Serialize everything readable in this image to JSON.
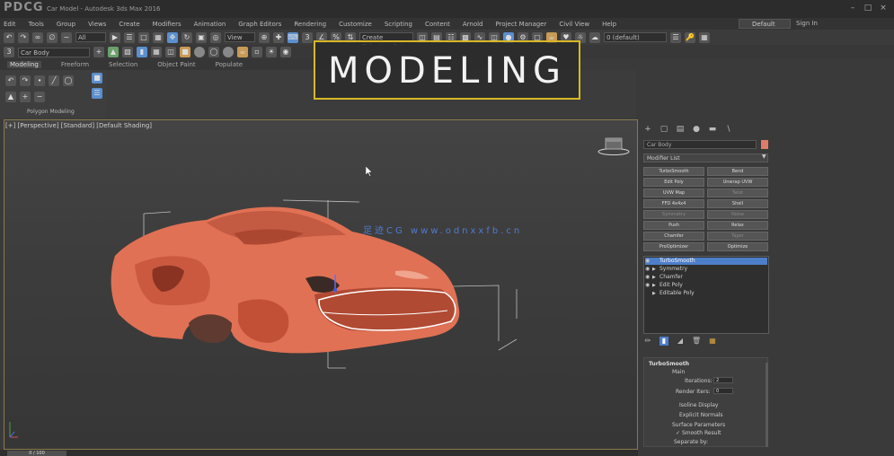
{
  "app": {
    "brand": "PDCG",
    "title": "Car Model - Autodesk 3ds Max 2016",
    "workspace": "Default",
    "signin": "Sign In"
  },
  "menu": [
    "Edit",
    "Tools",
    "Group",
    "Views",
    "Create",
    "Modifiers",
    "Animation",
    "Graph Editors",
    "Rendering",
    "Customize",
    "Scripting",
    "Content",
    "Arnold",
    "Project Manager",
    "Civil View",
    "Help"
  ],
  "toolbar": {
    "selection_filter": "All",
    "view_field": "View",
    "named_selection": "Create Selection Set",
    "layer_field": "0 (default)"
  },
  "ribbon": {
    "tabs": [
      "Modeling",
      "Freeform",
      "Selection",
      "Object Paint",
      "Populate"
    ],
    "active_tab": "Modeling",
    "panel_label": "Polygon Modeling"
  },
  "banner": {
    "text": "MODELING"
  },
  "viewport": {
    "label": "[+] [Perspective] [Standard] [Default Shading]",
    "watermark": "足迹CG  www.odnxxfb.cn",
    "car_color": "#e07155",
    "bg_color": "#3e3e3e"
  },
  "command_panel": {
    "icons": [
      "create-icon",
      "modify-icon",
      "hierarchy-icon",
      "motion-icon",
      "display-icon",
      "utilities-icon"
    ],
    "object_name": "Car Body",
    "object_color": "#e07b6a",
    "modifier_list": "Modifier List",
    "buttons": [
      {
        "label": "TurboSmooth",
        "dim": false
      },
      {
        "label": "Bend",
        "dim": false
      },
      {
        "label": "Edit Poly",
        "dim": false
      },
      {
        "label": "Unwrap UVW",
        "dim": false
      },
      {
        "label": "UVW Map",
        "dim": false
      },
      {
        "label": "Twist",
        "dim": true
      },
      {
        "label": "FFD 4x4x4",
        "dim": false
      },
      {
        "label": "Shell",
        "dim": false
      },
      {
        "label": "Symmetry",
        "dim": true
      },
      {
        "label": "Noise",
        "dim": true
      },
      {
        "label": "Push",
        "dim": false
      },
      {
        "label": "Relax",
        "dim": false
      },
      {
        "label": "Chamfer",
        "dim": false
      },
      {
        "label": "Taper",
        "dim": true
      },
      {
        "label": "ProOptimizer",
        "dim": false
      },
      {
        "label": "Optimize",
        "dim": false
      }
    ],
    "stack": [
      {
        "label": "TurboSmooth",
        "selected": true,
        "eye": true
      },
      {
        "label": "Symmetry",
        "selected": false,
        "eye": true
      },
      {
        "label": "Chamfer",
        "selected": false,
        "eye": true
      },
      {
        "label": "Edit Poly",
        "selected": false,
        "eye": true
      },
      {
        "label": "Editable Poly",
        "selected": false,
        "eye": false
      }
    ]
  },
  "rollout": {
    "title": "TurboSmooth",
    "section": "Main",
    "iterations_label": "Iterations:",
    "iterations_value": "2",
    "render_iters_label": "Render Iters:",
    "render_iters_value": "0",
    "isoline_label": "Isoline Display",
    "explicit_label": "Explicit Normals",
    "surface_label": "Surface Parameters",
    "smooth_label": "Smooth Result",
    "separate_label": "Separate by:"
  },
  "status": {
    "frame": "0 / 100"
  }
}
